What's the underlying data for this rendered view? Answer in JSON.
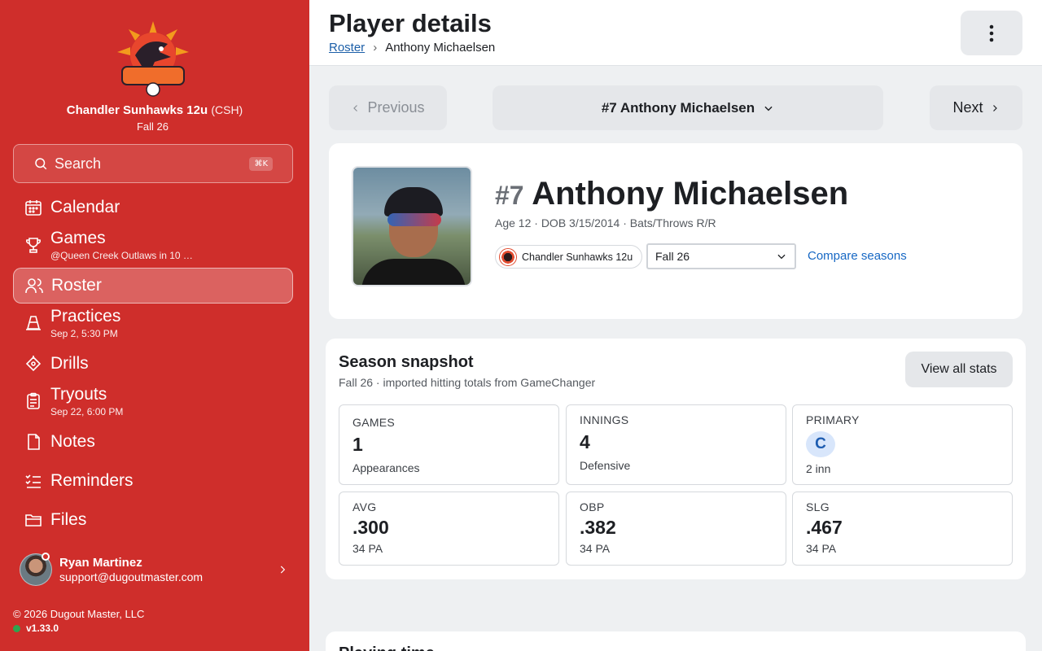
{
  "sidebar": {
    "team_name": "Chandler Sunhawks 12u",
    "team_abbr": "(CSH)",
    "season": "Fall 26",
    "logo_text": "SUNHAWKS",
    "search_label": "Search",
    "search_shortcut": "⌘K",
    "items": [
      {
        "label": "Calendar",
        "sub": "",
        "icon": "calendar-icon"
      },
      {
        "label": "Games",
        "sub": "@Queen Creek Outlaws in 10 …",
        "icon": "trophy-icon"
      },
      {
        "label": "Roster",
        "sub": "",
        "icon": "users-icon",
        "active": true
      },
      {
        "label": "Practices",
        "sub": "Sep 2, 5:30 PM",
        "icon": "cone-icon"
      },
      {
        "label": "Drills",
        "sub": "",
        "icon": "drill-icon"
      },
      {
        "label": "Tryouts",
        "sub": "Sep 22, 6:00 PM",
        "icon": "clipboard-icon"
      },
      {
        "label": "Notes",
        "sub": "",
        "icon": "note-icon"
      },
      {
        "label": "Reminders",
        "sub": "",
        "icon": "checklist-icon"
      },
      {
        "label": "Files",
        "sub": "",
        "icon": "folder-icon"
      }
    ],
    "user": {
      "name": "Ryan Martinez",
      "email": "support@dugoutmaster.com"
    },
    "copyright": "© 2026 Dugout Master, LLC",
    "version": "v1.33.0"
  },
  "header": {
    "title": "Player details",
    "breadcrumb_root": "Roster",
    "breadcrumb_sep": "›",
    "breadcrumb_current": "Anthony Michaelsen"
  },
  "player_nav": {
    "previous": "Previous",
    "selected": "#7 Anthony Michaelsen",
    "next": "Next"
  },
  "player": {
    "number": "#7",
    "name": "Anthony Michaelsen",
    "meta": "Age 12 · DOB 3/15/2014 · Bats/Throws R/R",
    "team_chip": "Chandler Sunhawks 12u",
    "season_select": "Fall 26",
    "compare_label": "Compare seasons"
  },
  "snapshot": {
    "title": "Season snapshot",
    "subtitle": "Fall 26 · imported hitting totals from GameChanger",
    "view_all": "View all stats",
    "stats": [
      {
        "label": "GAMES",
        "value": "1",
        "detail": "Appearances"
      },
      {
        "label": "INNINGS",
        "value": "4",
        "detail": "Defensive"
      },
      {
        "label": "PRIMARY",
        "value": "C",
        "detail": "2 inn"
      },
      {
        "label": "AVG",
        "value": ".300",
        "detail": "34 PA"
      },
      {
        "label": "OBP",
        "value": ".382",
        "detail": "34 PA"
      },
      {
        "label": "SLG",
        "value": ".467",
        "detail": "34 PA"
      }
    ]
  },
  "next_section_title": "Playing time",
  "colors": {
    "brand": "#cf2e2b",
    "link": "#1768c4",
    "badge": "#d8e6fb"
  }
}
